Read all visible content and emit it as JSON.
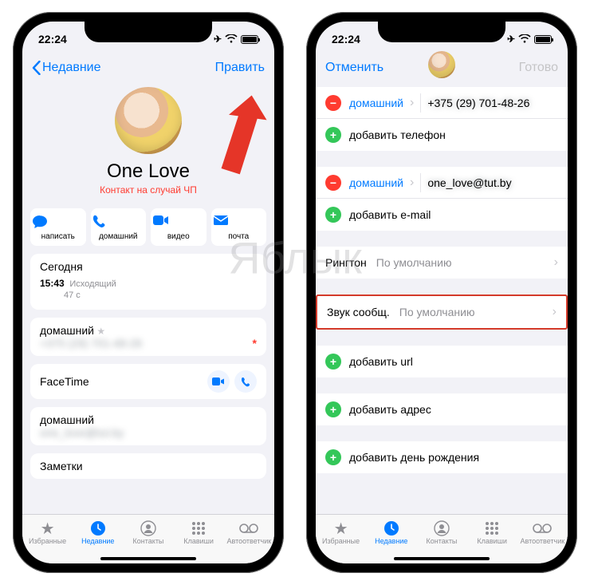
{
  "watermark": "Яблык",
  "status": {
    "time": "22:24"
  },
  "left": {
    "nav": {
      "back": "Недавние",
      "edit": "Править"
    },
    "contact": {
      "name": "One Love",
      "subtitle": "Контакт на случай ЧП"
    },
    "actions": {
      "message": "написать",
      "call": "домашний",
      "video": "видео",
      "mail": "почта"
    },
    "today": {
      "title": "Сегодня",
      "time": "15:43",
      "kind": "Исходящий",
      "duration": "47 с"
    },
    "phone": {
      "label": "домашний",
      "value": "+375 (29) 701-48-26"
    },
    "facetime": "FaceTime",
    "email": {
      "label": "домашний",
      "value": "one_love@tut.by"
    },
    "notes": "Заметки"
  },
  "right": {
    "nav": {
      "cancel": "Отменить",
      "done": "Готово"
    },
    "phone": {
      "label": "домашний",
      "value": "+375 (29) 701-48-26",
      "add": "добавить телефон"
    },
    "email": {
      "label": "домашний",
      "value": "one_love@tut.by",
      "add": "добавить e-mail"
    },
    "ringtone": {
      "title": "Рингтон",
      "value": "По умолчанию"
    },
    "texttone": {
      "title": "Звук сообщ.",
      "value": "По умолчанию"
    },
    "add_url": "добавить url",
    "add_address": "добавить адрес",
    "add_birthday": "добавить день рождения"
  },
  "tabs": {
    "favorites": "Избранные",
    "recents": "Недавние",
    "contacts": "Контакты",
    "keypad": "Клавиши",
    "voicemail": "Автоответчик"
  }
}
